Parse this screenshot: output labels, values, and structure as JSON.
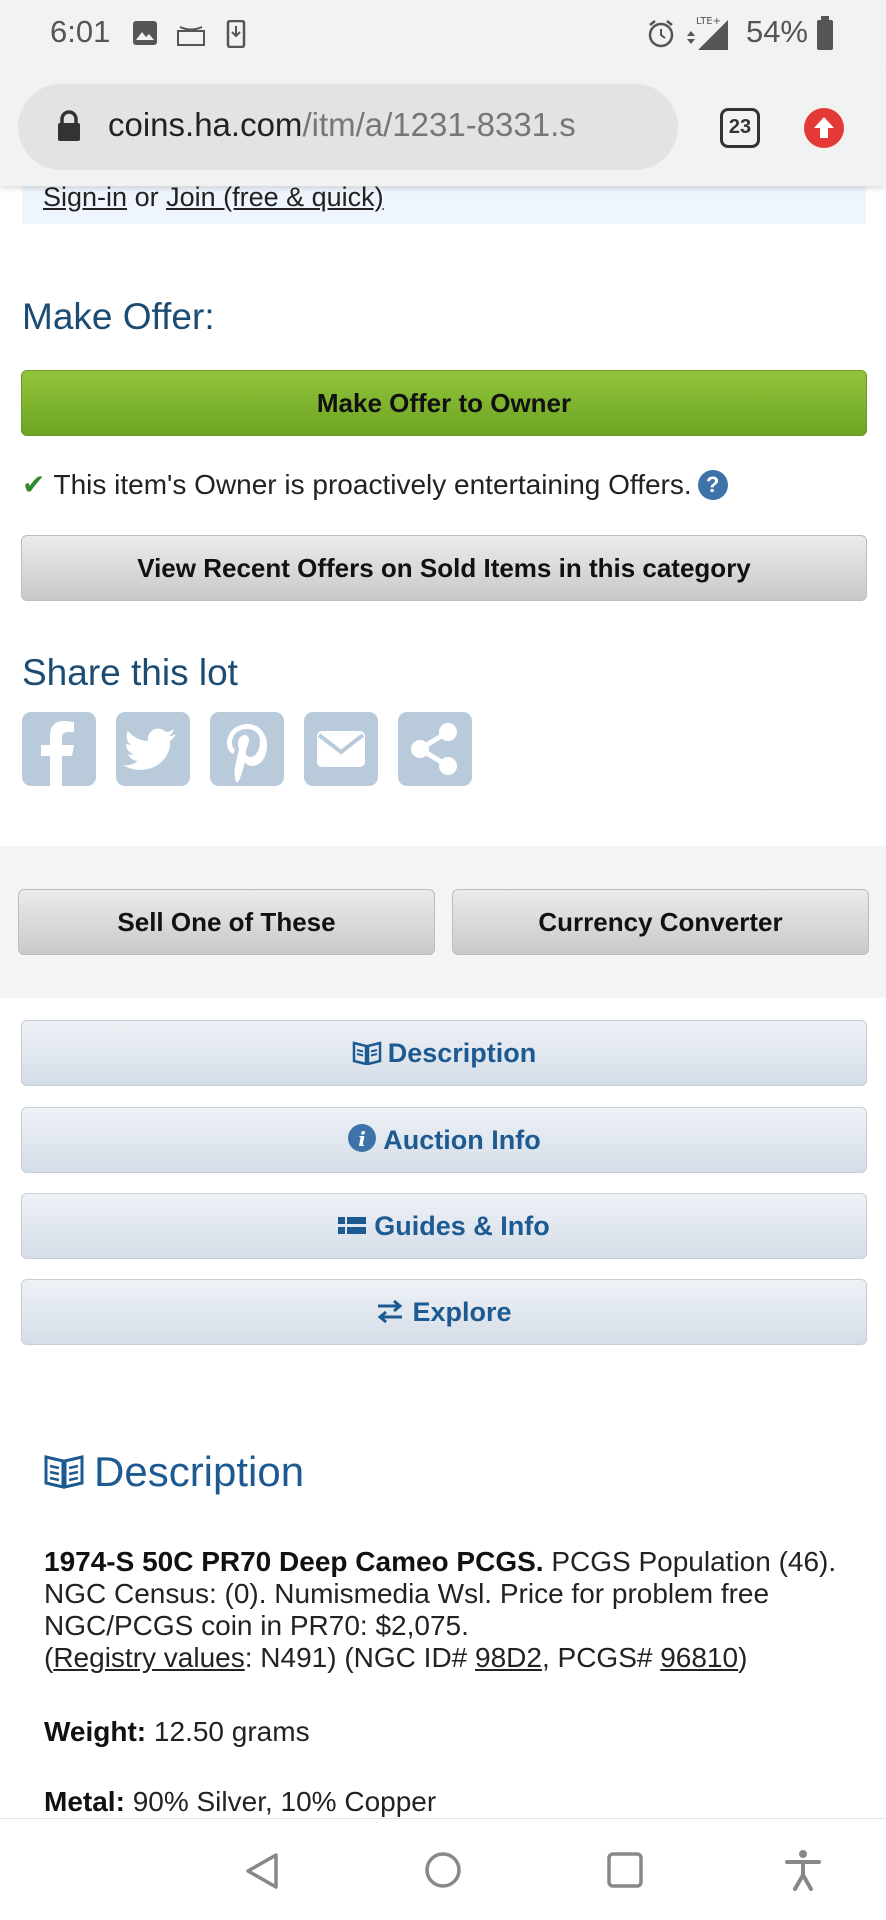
{
  "status_bar": {
    "time": "6:01",
    "icons": [
      "image-icon",
      "amazon-icon",
      "download-icon",
      "alarm-icon",
      "lte-signal-icon",
      "battery-icon"
    ],
    "network": "LTE+",
    "battery": "54%"
  },
  "browser": {
    "url_domain": "coins.ha.com",
    "url_path": "/itm/a/1231-8331.s",
    "tab_count": "23"
  },
  "signin": {
    "signin_link": "Sign-in",
    "or_text": "or",
    "join_link": "Join (free & quick)"
  },
  "make_offer": {
    "heading": "Make Offer:",
    "button": "Make Offer to Owner",
    "note": "This item's Owner is proactively entertaining Offers.",
    "help": "?",
    "recent_offers_button": "View Recent Offers on Sold Items in this category"
  },
  "share": {
    "heading": "Share this lot",
    "buttons": [
      "facebook-icon",
      "twitter-icon",
      "pinterest-icon",
      "email-icon",
      "share-icon"
    ]
  },
  "actions": {
    "sell_button": "Sell One of These",
    "currency_button": "Currency Converter"
  },
  "accordion": {
    "description": "Description",
    "auction_info": "Auction Info",
    "guides_info": "Guides & Info",
    "explore": "Explore"
  },
  "description": {
    "heading": "Description",
    "title_bold": "1974-S 50C PR70 Deep Cameo PCGS.",
    "body_1": "PCGS Population (46). NGC Census: (0). Numismedia Wsl. Price for problem free NGC/PCGS coin in PR70: $2,075.",
    "paren_open": "(",
    "registry_link": "Registry values",
    "registry_value": ": N491) (NGC ID# ",
    "ngc_id_link": "98D2",
    "pcgs_text": ", PCGS# ",
    "pcgs_link": "96810",
    "paren_close": ")",
    "weight_label": "Weight:",
    "weight_value": "12.50 grams",
    "metal_label": "Metal:",
    "metal_value": "90% Silver, 10% Copper"
  },
  "nav": {
    "back": "back-icon",
    "home": "home-icon",
    "recents": "recents-icon",
    "accessibility": "accessibility-icon"
  }
}
